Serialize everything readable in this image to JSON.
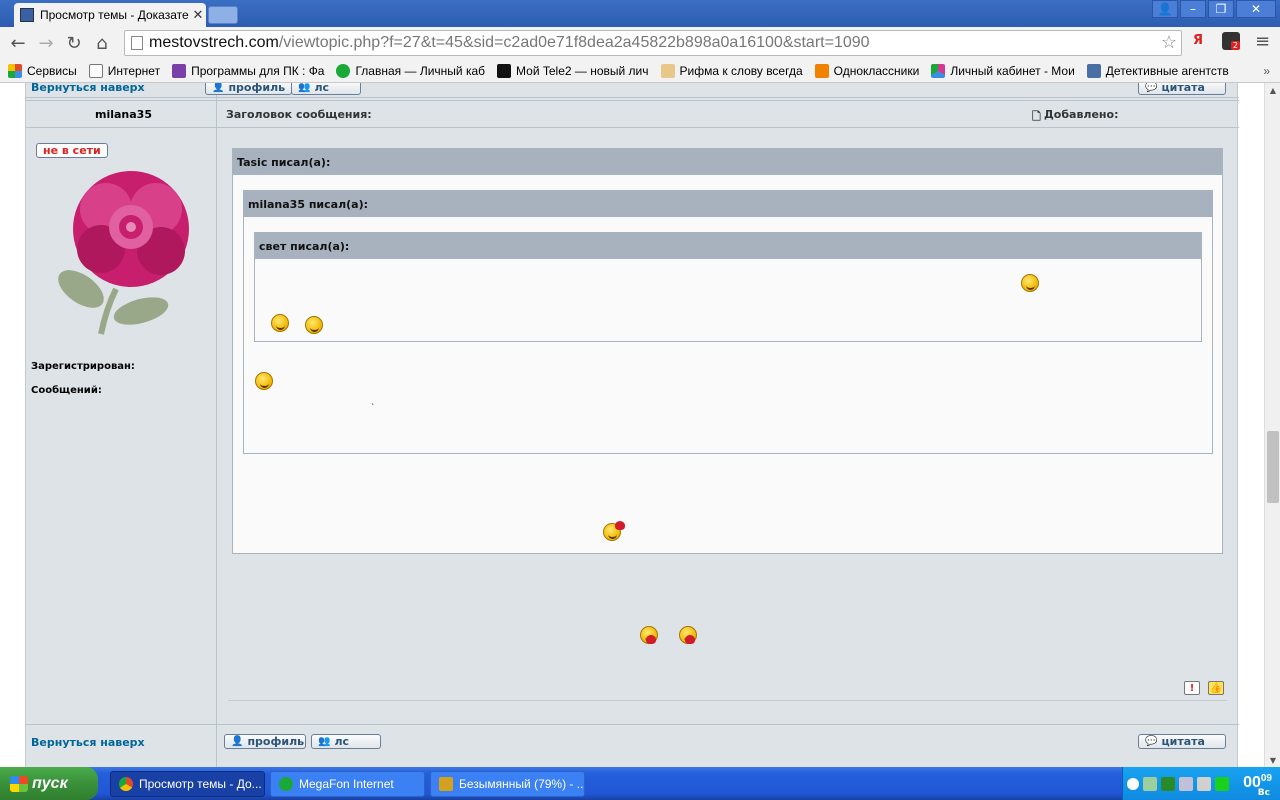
{
  "browser": {
    "tab_title": "Просмотр темы - Доказате",
    "url_host": "mestovstrech.com",
    "url_path": "/viewtopic.php?f=27&t=45&sid=c2ad0e71f8dea2a45822b898a0a16100&start=1090",
    "yandex_label": "Я",
    "ext_badge": "2"
  },
  "bookmarks": [
    {
      "label": "Сервисы",
      "color": "#e04b2b"
    },
    {
      "label": "Интернет",
      "color": "#ffffff"
    },
    {
      "label": "Программы для ПК : Фа",
      "color": "#7b3fa8"
    },
    {
      "label": "Главная — Личный каб",
      "color": "#1aa839"
    },
    {
      "label": "Мой Tele2 — новый лич",
      "color": "#111111"
    },
    {
      "label": "Рифма к слову всегда",
      "color": "#e8c88a"
    },
    {
      "label": "Одноклассники",
      "color": "#f08200"
    },
    {
      "label": "Личный кабинет - Мои",
      "color": "#d33a8f"
    },
    {
      "label": "Детективные агентств",
      "color": "#4a6fa5"
    }
  ],
  "post": {
    "top_back_link": "Вернуться наверх",
    "top_profile": "профиль",
    "top_pm": "лс",
    "top_quote": "цитата",
    "author": "milana35",
    "subject_label": "Заголовок сообщения:",
    "added_label": "Добавлено:",
    "status": "не в сети",
    "registered_label": "Зарегистрирован:",
    "posts_label": "Сообщений:",
    "quote1_header": "Tasic писал(а):",
    "quote2_header": "milana35 писал(а):",
    "quote3_header": "свет писал(а):",
    "stray_char": "`",
    "report_btn": "!",
    "rate_btn": "👍",
    "bottom_back_link": "Вернуться наверх",
    "bottom_profile": "профиль",
    "bottom_pm": "лс",
    "bottom_quote": "цитата"
  },
  "taskbar": {
    "start": "пуск",
    "tasks": [
      {
        "label": "Просмотр темы - До...",
        "color": "#e04b2b"
      },
      {
        "label": "MegaFon Internet",
        "color": "#1aa839"
      },
      {
        "label": "Безымянный (79%) - ...",
        "color": "#d4a020"
      }
    ],
    "clock_hm": "00",
    "clock_min": "09",
    "clock_day": "Вс"
  }
}
